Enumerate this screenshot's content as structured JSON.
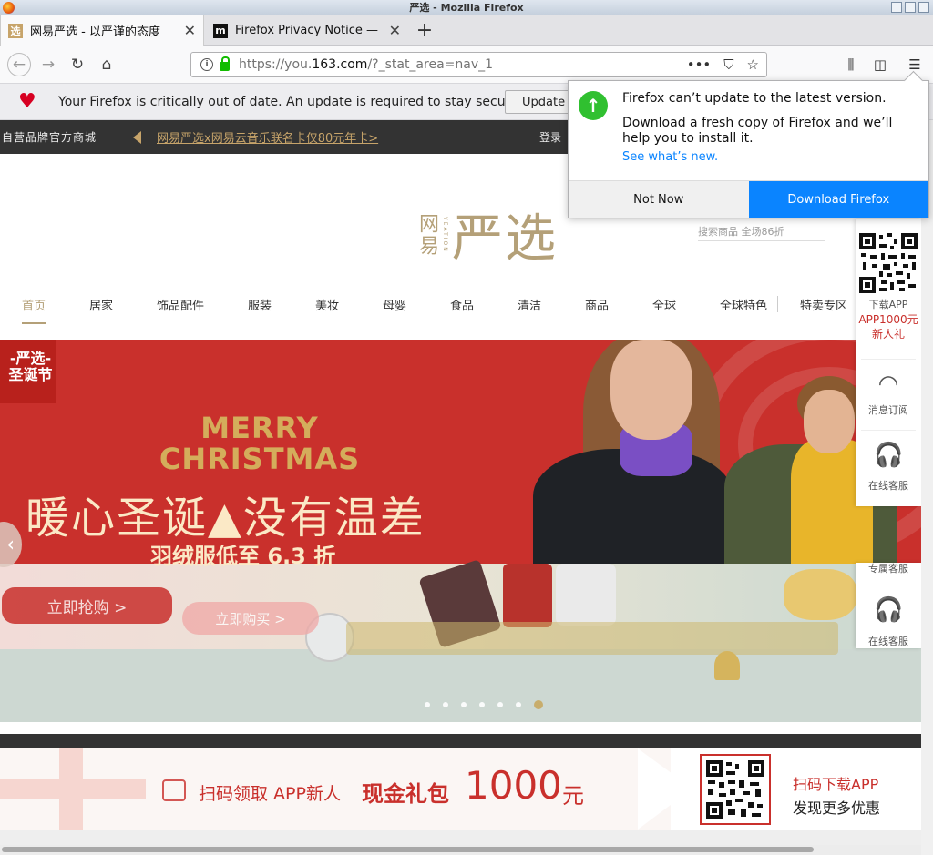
{
  "window": {
    "title": "严选 - Mozilla Firefox"
  },
  "tabs": [
    {
      "label": "网易严选 - 以严谨的态度",
      "favicon": "选"
    },
    {
      "label": "Firefox Privacy Notice — M",
      "favicon": "m"
    }
  ],
  "nav": {
    "url_prefix": "https://you.",
    "url_domain": "163.com",
    "url_path": "/?_stat_area=nav_1"
  },
  "update_notice": {
    "message": "Your Firefox is critically out of date. An update is required to stay secure.",
    "button": "Update"
  },
  "popup": {
    "heading": "Firefox can’t update to the latest version.",
    "body": "Download a fresh copy of Firefox and we’ll help you to install it.",
    "link": "See what’s new.",
    "not_now": "Not Now",
    "download": "Download Firefox"
  },
  "site": {
    "topbar_left": "自营品牌官方商城",
    "topbar_promo": "网易严选x网易云音乐联名卡仅80元年卡>",
    "topbar_right": "登录",
    "logo_small": "网易",
    "logo_latin": "YEATION",
    "logo_big": "严选",
    "search_hint": "搜索商品 全场86折",
    "categories": [
      "首页",
      "居家",
      "饰品配件",
      "服装",
      "美妆",
      "母婴",
      "食品",
      "清洁",
      "商品",
      "全球",
      "全球特色",
      "特卖专区"
    ],
    "banner": {
      "tag": "-严选-\n圣诞节",
      "merry": "MERRY\nCHRISTMAS",
      "headline": "暖心圣诞▲没有温差",
      "sale": "羽绒服低至 6.3 折",
      "buy1": "立即抢购 >",
      "buy2": "立即购买 >",
      "slides": 7,
      "active_slide": 7
    },
    "sidebar": {
      "qr_label": "下载APP",
      "app_reward": "APP1000元",
      "app_reward2": "新人礼",
      "feed": "消息订阅",
      "service": "在线客服",
      "service2_top": "专属客服",
      "service2": "在线客服"
    },
    "app_banner": {
      "t1": "扫码领取 APP新人",
      "t2": "现金礼包",
      "t3": "1000",
      "t4": "元",
      "s1": "扫码下载APP",
      "s2": "发现更多优惠"
    }
  },
  "colors": {
    "accent": "#b4a078",
    "red": "#c9302c",
    "firefox_blue": "#0a84ff"
  }
}
